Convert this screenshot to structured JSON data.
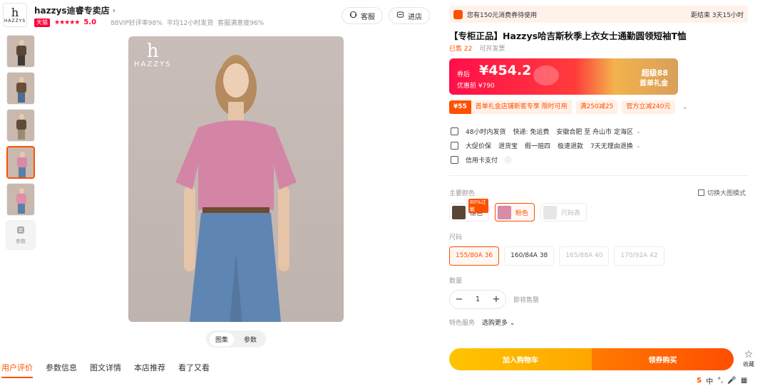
{
  "shop": {
    "logo_h": "h",
    "logo_word": "HAZZYS",
    "name": "hazzys迪睿专卖店",
    "chevron": "›",
    "tmall_badge": "天猫",
    "stars": "★★★★★",
    "rating": "5.0",
    "meta": [
      "88VIP好评率98%",
      "平均12小时发货",
      "客服满意度96%"
    ],
    "kefu_label": "客服",
    "jindian_label": "进店"
  },
  "gallery": {
    "thumb_colors": [
      "#5b4636",
      "#6b4d37",
      "#5f4a37",
      "#d88aa8",
      "#de8fa9"
    ],
    "active_index": 3,
    "param_label": "参数",
    "brand_h": "h",
    "brand_word": "HAZZYS",
    "view_tabs": [
      "图集",
      "参数"
    ]
  },
  "bottom_tabs": [
    "用户评价",
    "参数信息",
    "图文详情",
    "本店推荐",
    "看了又看"
  ],
  "coupon_banner": {
    "text": "您有150元消费券待使用",
    "countdown": "距结束 3天15小时"
  },
  "product": {
    "title": "【专柜正品】Hazzys哈吉斯秋季上衣女士通勤圆领短袖T恤",
    "sold": "已售 22",
    "shipping_note": "可开发票"
  },
  "price": {
    "label": "券后",
    "value": "¥454.2",
    "original": "优惠前 ¥790",
    "promo_line1": "超级88",
    "promo_line2": "首单礼金"
  },
  "tags": {
    "t1_amount": "¥55",
    "t1_desc": "首单礼金店铺新客专享 限时可用",
    "t2": "满250减25",
    "t3": "官方立减240元",
    "more": "⌄"
  },
  "services": {
    "row1": [
      "48小时内发货",
      "快递: 免运费",
      "安徽合肥 至 舟山市 定海区"
    ],
    "row2": [
      "大促价保",
      "退货宝",
      "假一赔四",
      "极速退款",
      "7天无理由退换"
    ],
    "row3": [
      "信用卡支付"
    ]
  },
  "color_section": {
    "label": "主要颜色",
    "switch_label": "切换大图模式",
    "options": [
      {
        "name": "棕色",
        "swatch": "#5b4636",
        "badge": "80%过敏"
      },
      {
        "name": "粉色",
        "swatch": "#d88aa8"
      },
      {
        "name": "尺码表",
        "swatch": "#dddddd"
      }
    ]
  },
  "size_section": {
    "label": "尺码",
    "options": [
      "155/80A 36",
      "160/84A 38",
      "165/88A 40",
      "170/92A 42"
    ]
  },
  "quantity": {
    "label": "数量",
    "minus": "−",
    "value": "1",
    "plus": "+",
    "stock": "即将售罄"
  },
  "special": {
    "label": "特色服务",
    "more": "选购更多 ⌄"
  },
  "actions": {
    "cart": "加入购物车",
    "buy": "领券购买",
    "fav_icon": "☆",
    "fav_label": "收藏"
  },
  "ime": [
    "S",
    "中",
    "°,",
    "🎤",
    "▦"
  ],
  "colors": {
    "accent": "#ff5000",
    "tmall_red": "#ff0036"
  }
}
